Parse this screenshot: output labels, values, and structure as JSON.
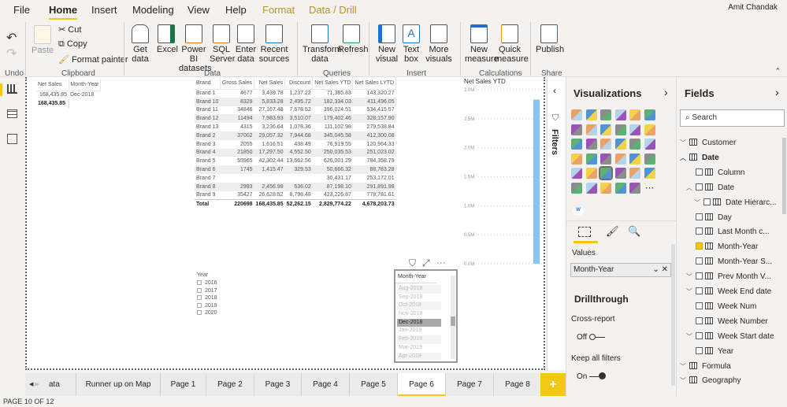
{
  "ribbon": {
    "tabs": [
      "File",
      "Home",
      "Insert",
      "Modeling",
      "View",
      "Help",
      "Format",
      "Data / Drill"
    ],
    "active_tab": "Home",
    "user": "Amit Chandak",
    "undo_group": "Undo",
    "clipboard": {
      "paste": "Paste",
      "cut": "Cut",
      "copy": "Copy",
      "format_painter": "Format painter",
      "group": "Clipboard"
    },
    "data": {
      "get_data": "Get data",
      "excel": "Excel",
      "pbi_datasets": "Power BI datasets",
      "sql": "SQL Server",
      "enter_data": "Enter data",
      "recent": "Recent sources",
      "group": "Data"
    },
    "queries": {
      "transform": "Transform data",
      "refresh": "Refresh",
      "group": "Queries"
    },
    "insert": {
      "new_visual": "New visual",
      "text_box": "Text box",
      "more_visuals": "More visuals",
      "group": "Insert"
    },
    "calculations": {
      "new_measure": "New measure",
      "quick_measure": "Quick measure",
      "group": "Calculations"
    },
    "share": {
      "publish": "Publish",
      "group": "Share"
    }
  },
  "card_table": {
    "headers": [
      "Net Sales",
      "Month-Year"
    ],
    "row": [
      "168,435.85",
      "Dec-2018"
    ],
    "total": "168,435.85"
  },
  "brand_table": {
    "headers": [
      "Brand",
      "Gross Sales",
      "Net Sales",
      "Discount",
      "Net Sales YTD",
      "Net Sales LYTD"
    ],
    "rows": [
      [
        "Brand 1",
        "4677",
        "3,439.78",
        "1,237.22",
        "71,385.83",
        "143,320.27"
      ],
      [
        "Brand 10",
        "8329",
        "5,833.28",
        "2,495.72",
        "182,334.03",
        "411,496.05"
      ],
      [
        "Brand 11",
        "34846",
        "27,167.48",
        "7,678.52",
        "396,024.51",
        "534,415.57"
      ],
      [
        "Brand 12",
        "11494",
        "7,983.93",
        "3,510.07",
        "179,402.46",
        "328,157.90"
      ],
      [
        "Brand 13",
        "4315",
        "3,236.64",
        "1,078.36",
        "111,102.98",
        "279,538.84"
      ],
      [
        "Brand 2",
        "37002",
        "29,057.32",
        "7,944.68",
        "345,045.58",
        "412,300.08"
      ],
      [
        "Brand 3",
        "2055",
        "1,616.51",
        "438.49",
        "76,919.55",
        "120,964.33"
      ],
      [
        "Brand 4",
        "21850",
        "17,297.50",
        "4,552.50",
        "250,035.53",
        "251,023.02"
      ],
      [
        "Brand 5",
        "55965",
        "42,302.44",
        "13,662.56",
        "626,001.29",
        "784,358.79"
      ],
      [
        "Brand 6",
        "1745",
        "1,415.47",
        "329.53",
        "50,666.32",
        "88,783.28"
      ],
      [
        "Brand 7",
        "",
        "",
        "",
        "30,431.17",
        "253,172.01"
      ],
      [
        "Brand 8",
        "2993",
        "2,456.98",
        "536.02",
        "87,198.10",
        "291,891.98"
      ],
      [
        "Brand 9",
        "35427",
        "26,628.52",
        "8,798.48",
        "423,226.87",
        "778,781.61"
      ]
    ],
    "total": [
      "Total",
      "220698",
      "168,435.85",
      "52,262.15",
      "2,829,774.22",
      "4,678,203.73"
    ]
  },
  "chart_data": {
    "type": "bar",
    "title": "Net Sales YTD",
    "categories": [
      ""
    ],
    "values": [
      2829774.22
    ],
    "ylim": [
      0,
      3000000
    ],
    "yticks": [
      "0.0M",
      "0.5M",
      "1.0M",
      "1.5M",
      "2.0M",
      "2.5M",
      "3.0M"
    ],
    "grid": true,
    "color": "#8ac4f4"
  },
  "year_slicer": {
    "title": "Year",
    "items": [
      "2016",
      "2017",
      "2018",
      "2019",
      "2020"
    ]
  },
  "month_slicer": {
    "title": "Month-Year",
    "items": [
      "Aug-2018",
      "Sep-2018",
      "Oct-2018",
      "Nov-2018",
      "Dec-2018",
      "Jan-2019",
      "Feb-2019",
      "Mar-2019",
      "Apr-2019"
    ],
    "selected": "Dec-2018"
  },
  "filters_label": "Filters",
  "visualizations": {
    "title": "Visualizations",
    "values_label": "Values",
    "values_field": "Month-Year",
    "drillthrough": "Drillthrough",
    "cross_report": "Cross-report",
    "cross_report_state": "Off",
    "keep_filters": "Keep all filters",
    "keep_filters_state": "On",
    "custom_visual_badge": "W"
  },
  "fields": {
    "title": "Fields",
    "search_placeholder": "Search",
    "items": [
      {
        "label": "Customer",
        "level": 0,
        "type": "table",
        "exp": "v"
      },
      {
        "label": "Date",
        "level": 0,
        "type": "table",
        "exp": "^",
        "bold": true
      },
      {
        "label": "Column",
        "level": 1,
        "type": "col"
      },
      {
        "label": "Date",
        "level": 1,
        "type": "col",
        "exp": "^"
      },
      {
        "label": "Date Hierarc...",
        "level": 2,
        "type": "hier",
        "exp": "v"
      },
      {
        "label": "Day",
        "level": 1,
        "type": "col"
      },
      {
        "label": "Last Month c...",
        "level": 1,
        "type": "col"
      },
      {
        "label": "Month-Year",
        "level": 1,
        "type": "col",
        "checked": true
      },
      {
        "label": "Month-Year S...",
        "level": 1,
        "type": "col"
      },
      {
        "label": "Prev Month V...",
        "level": 1,
        "type": "col",
        "exp": "v"
      },
      {
        "label": "Week End date",
        "level": 1,
        "type": "col",
        "exp": "v"
      },
      {
        "label": "Week Num",
        "level": 1,
        "type": "col"
      },
      {
        "label": "Week Number",
        "level": 1,
        "type": "col"
      },
      {
        "label": "Week Start date",
        "level": 1,
        "type": "col",
        "exp": "v"
      },
      {
        "label": "Year",
        "level": 1,
        "type": "col"
      },
      {
        "label": "Formula",
        "level": 0,
        "type": "table",
        "exp": "v"
      },
      {
        "label": "Geography",
        "level": 0,
        "type": "table",
        "exp": "v"
      }
    ]
  },
  "page_tabs": [
    "ata",
    "Runner up on Map",
    "Page 1",
    "Page 2",
    "Page 3",
    "Page 4",
    "Page 5",
    "Page 6",
    "Page 7",
    "Page 8"
  ],
  "active_page": "Page 6",
  "status": "PAGE 10 OF 12",
  "colors": {
    "accent": "#f2c811",
    "bar": "#8ac4f4"
  }
}
